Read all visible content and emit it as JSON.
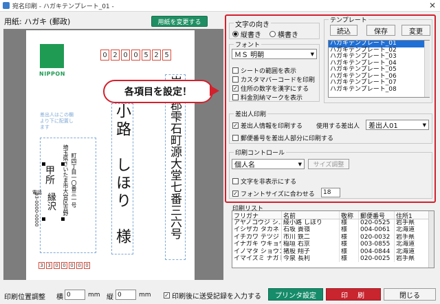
{
  "window": {
    "title": "宛名印刷 - ハガキテンプレート_01 -",
    "close": "✕"
  },
  "header": {
    "paper_label": "用紙: ハガキ (郵政)",
    "change_paper": "用紙を変更する"
  },
  "preview": {
    "logo_text": "NIPPON",
    "zip_top": [
      "0",
      "2",
      "0",
      "0",
      "5",
      "2",
      "5"
    ],
    "zip_bottom": [
      "3",
      "3",
      "0",
      "0",
      "0",
      "0",
      "0"
    ],
    "address_col1": "岩手郡雫石町源大堂七番三六号",
    "name_col": "小路　しほり　様",
    "sender_hint": "差出人はこの欄より下に配置します",
    "sender_address": "埼玉県さいたま市大宮区吉野",
    "sender_address2": "町四丁目一〇番三一号",
    "sender_name_part1": "甲所",
    "sender_name_part2": "縁沢",
    "sender_phone": "03-0000-0000",
    "sender_phone_label": "電話"
  },
  "callout": {
    "text": "各項目を設定！"
  },
  "direction": {
    "label": "文字の向き",
    "vertical": "縦書き",
    "horizontal": "横書き"
  },
  "font": {
    "label": "フォント",
    "value": "ＭＳ 明朝"
  },
  "options": {
    "sheet_range": "シートの範囲を表示",
    "customer_barcode": "カスタマバーコードを印刷",
    "kanji_numbers": "住所の数字を漢字にする",
    "postage_mark": "料金別納マークを表示"
  },
  "template": {
    "label": "テンプレート",
    "load": "読込",
    "save": "保存",
    "change": "変更",
    "items": [
      "ハガキテンプレート_01",
      "ハガキテンプレート_02",
      "ハガキテンプレート_03",
      "ハガキテンプレート_04",
      "ハガキテンプレート_05",
      "ハガキテンプレート_06",
      "ハガキテンプレート_07",
      "ハガキテンプレート_08"
    ]
  },
  "sender": {
    "label": "差出人印刷",
    "print_info": "差出人情報を印刷する",
    "use_label": "使用する差出人",
    "use_value": "差出人01",
    "zip_in_sender": "郵便番号を差出人部分に印刷する"
  },
  "print_control": {
    "label": "印刷コントロール",
    "value": "個人名",
    "size_adjust": "サイズ調整",
    "hide_text": "文字を非表示にする",
    "fit_font": "フォントサイズに合わせる",
    "font_size": "18"
  },
  "print_list": {
    "label": "印刷リスト",
    "columns": [
      "フリガナ",
      "名前",
      "敬称",
      "郵便番号",
      "住所1"
    ],
    "rows": [
      [
        "アヤノコウジ シ…",
        "綾小路 しほり",
        "様",
        "020-0525",
        "岩手県"
      ],
      [
        "イシザカ タカネ",
        "石坂 貴嶺",
        "様",
        "004-0061",
        "北海道"
      ],
      [
        "イチカワ テツジ",
        "市川 鉄二",
        "様",
        "020-0032",
        "岩手県"
      ],
      [
        "イナガキ ウキョウ",
        "稲垣 右京",
        "様",
        "003-0855",
        "北海道"
      ],
      [
        "イノマタ ショウコ",
        "猪股 翔子",
        "様",
        "004-0844",
        "北海道"
      ],
      [
        "イマイズミ ナガト…",
        "今泉 長利",
        "様",
        "020-0025",
        "岩手県"
      ]
    ]
  },
  "footer": {
    "position_label": "印刷位置調整",
    "h_label": "横",
    "h_value": "0",
    "v_label": "縦",
    "v_value": "0",
    "unit": "mm",
    "record_send": "印刷後に送受記録を入力する",
    "printer_settings": "プリンタ設定",
    "print": "印　刷",
    "close": "閉じる"
  }
}
